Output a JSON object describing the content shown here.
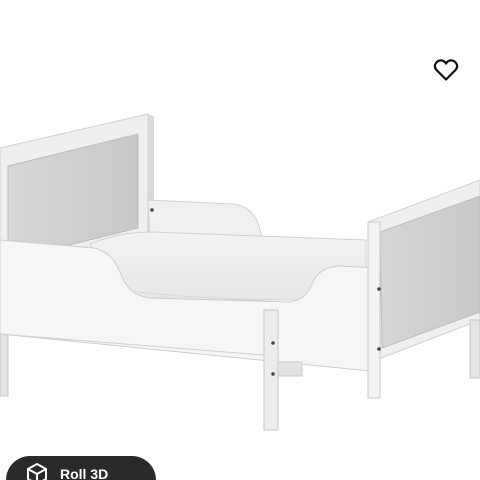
{
  "product": {
    "image_name": "extendable-bed-frame-white"
  },
  "actions": {
    "favorite_icon": "heart-outline-icon",
    "view_3d_label": "Roll 3D",
    "view_3d_icon": "cube-rotate-icon"
  },
  "colors": {
    "background": "#ffffff",
    "bed_frame": "#f1f1f1",
    "bed_shadow": "#bdbdbd",
    "mattress": "#ececec",
    "button_dark": "#2a2a2a"
  }
}
